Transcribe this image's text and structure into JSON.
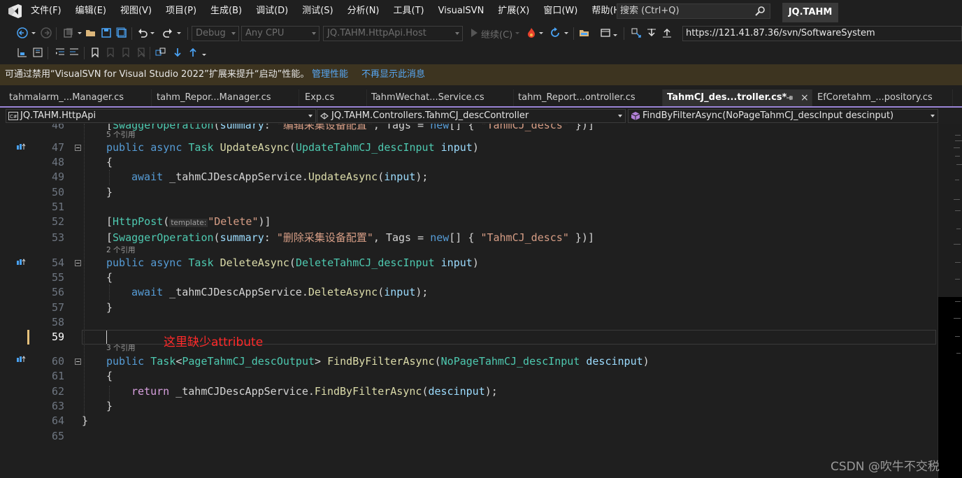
{
  "menubar": {
    "items": [
      "文件(F)",
      "编辑(E)",
      "视图(V)",
      "项目(P)",
      "生成(B)",
      "调试(D)",
      "测试(S)",
      "分析(N)",
      "工具(T)",
      "VisualSVN",
      "扩展(X)",
      "窗口(W)",
      "帮助(H)"
    ],
    "search_placeholder": "搜索 (Ctrl+Q)",
    "solution_name": "JQ.TAHM"
  },
  "toolbar": {
    "config": "Debug",
    "platform": "Any CPU",
    "startup_project": "JQ.TAHM.HttpApi.Host",
    "continue_label": "继续(C)",
    "svn_url": "https://121.41.87.36/svn/SoftwareSystem"
  },
  "infobar": {
    "message": "可通过禁用“VisualSVN for Visual Studio 2022”扩展来提升“启动”性能。",
    "link_manage": "管理性能",
    "link_dismiss": "不再显示此消息"
  },
  "tabs": [
    {
      "label": "tahmalarm_...Manager.cs"
    },
    {
      "label": "tahm_Repor...Manager.cs"
    },
    {
      "label": "Exp.cs"
    },
    {
      "label": "TahmWechat...Service.cs"
    },
    {
      "label": "tahm_Report...ontroller.cs"
    },
    {
      "label": "TahmCJ_des...troller.cs*"
    },
    {
      "label": "EfCoretahm_...pository.cs"
    }
  ],
  "navbar": {
    "project": "JQ.TAHM.HttpApi",
    "class": "JQ.TAHM.Controllers.TahmCJ_descController",
    "member": "FindByFilterAsync(NoPageTahmCJ_descInput descinput)"
  },
  "editor": {
    "line_numbers": [
      "46",
      "47",
      "48",
      "49",
      "50",
      "51",
      "52",
      "53",
      "54",
      "55",
      "56",
      "57",
      "58",
      "59",
      "60",
      "61",
      "62",
      "63",
      "64",
      "65"
    ],
    "codelens": [
      "5 个引用",
      "2 个引用",
      "3 个引用"
    ],
    "annotation": "这里缺少attribute",
    "line46": {
      "open": "[",
      "attr": "SwaggerOperation",
      "p1": "(",
      "summary": "summary",
      "colon": ": ",
      "str": "\"编辑采集设备配置\"",
      "rest": ", Tags = ",
      "new": "new",
      "arr": "[] { ",
      "tag": "\"TahmCJ_descs\"",
      "end": " })]"
    },
    "line47": {
      "k1": "public",
      "k2": "async",
      "type": "Task",
      "name": "UpdateAsync",
      "open": "(",
      "ptype": "UpdateTahmCJ_descInput",
      "pname": "input",
      "close": ")"
    },
    "brace_open": "{",
    "brace_close": "}",
    "line49": {
      "k": "await",
      "obj": " _tahmCJDescAppService.",
      "m": "UpdateAsync",
      "open": "(",
      "p": "input",
      "close": ");"
    },
    "line52": {
      "open": "[",
      "attr": "HttpPost",
      "p1": "(",
      "hint": "template:",
      "str": "\"Delete\"",
      "end": ")]"
    },
    "line53": {
      "open": "[",
      "attr": "SwaggerOperation",
      "p1": "(",
      "summary": "summary",
      "colon": ": ",
      "str": "\"删除采集设备配置\"",
      "rest": ", Tags = ",
      "new": "new",
      "arr": "[] { ",
      "tag": "\"TahmCJ_descs\"",
      "end": " })]"
    },
    "line54": {
      "k1": "public",
      "k2": "async",
      "type": "Task",
      "name": "DeleteAsync",
      "open": "(",
      "ptype": "DeleteTahmCJ_descInput",
      "pname": "input",
      "close": ")"
    },
    "line56": {
      "k": "await",
      "obj": " _tahmCJDescAppService.",
      "m": "DeleteAsync",
      "open": "(",
      "p": "input",
      "close": ");"
    },
    "line60": {
      "k1": "public",
      "type": "Task",
      "lt": "<",
      "gtype": "PageTahmCJ_descOutput",
      "gt": ">",
      "name": "FindByFilterAsync",
      "open": "(",
      "ptype": "NoPageTahmCJ_descInput",
      "pname": "descinput",
      "close": ")"
    },
    "line62": {
      "k": "return",
      "obj": " _tahmCJDescAppService.",
      "m": "FindByFilterAsync",
      "open": "(",
      "p": "descinput",
      "close": ");"
    },
    "line64": "}"
  },
  "watermark": "CSDN @吹牛不交税",
  "colors": {
    "keyword": "#569cd6",
    "type": "#4ec9b0",
    "method": "#dcdcaa",
    "param": "#9cdcfe",
    "string": "#d69d85",
    "control": "#d8a0df",
    "annotation": "#ff2a2a",
    "infobar_bg": "#3d3420",
    "tab_accent": "#9a84d6"
  }
}
